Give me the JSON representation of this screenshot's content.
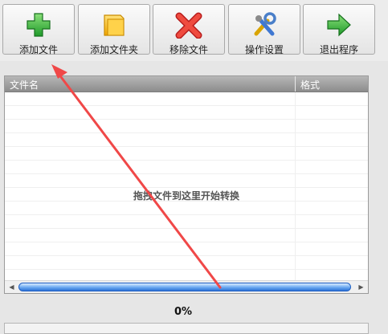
{
  "toolbar": {
    "buttons": [
      {
        "label": "添加文件",
        "icon": "plus-icon"
      },
      {
        "label": "添加文件夹",
        "icon": "folder-icon"
      },
      {
        "label": "移除文件",
        "icon": "remove-x-icon"
      },
      {
        "label": "操作设置",
        "icon": "tools-icon"
      },
      {
        "label": "退出程序",
        "icon": "exit-arrow-icon"
      }
    ]
  },
  "file_list": {
    "columns": [
      "文件名",
      "格式"
    ],
    "rows": [],
    "drop_hint": "拖拽文件到这里开始转换"
  },
  "progress": {
    "percent_text": "0%",
    "value": 0
  },
  "colors": {
    "add_icon": "#3cb43c",
    "folder_icon": "#f4b400",
    "remove_icon": "#e53935",
    "exit_icon": "#2ea82e",
    "annotation_arrow": "#f04848",
    "scrollbar": "#3a86e8"
  }
}
